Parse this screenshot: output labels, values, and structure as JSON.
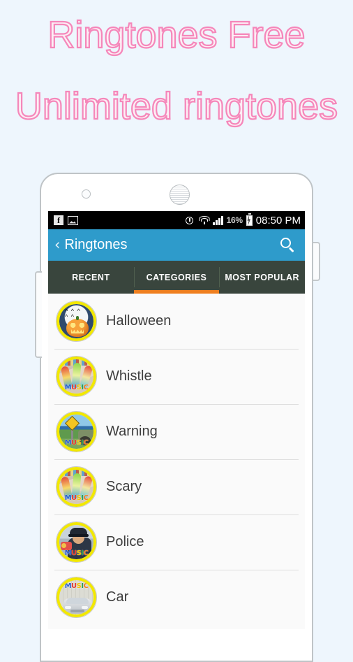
{
  "promo": {
    "line1": "Ringtones Free",
    "line2": "Unlimited ringtones",
    "text_color": "#fdeef5",
    "outline_color": "#f587ba",
    "background_color": "#eef6fd"
  },
  "phone": {
    "frame_color": "#ffffff",
    "frame_border_color": "#bfc4c7",
    "camera": "camera-dot",
    "speaker": "speaker-grille",
    "volume_button": "volume-button",
    "power_button": "power-button"
  },
  "statusbar": {
    "background_color": "#000000",
    "left_icons": [
      "facebook-icon",
      "image-icon"
    ],
    "facebook_glyph": "f",
    "right_icons": [
      "alarm-icon",
      "wifi-icon",
      "signal-icon",
      "battery-icon"
    ],
    "battery_percent": "16%",
    "clock": "08:50 PM"
  },
  "appbar": {
    "background_color": "#2e9bcb",
    "back_glyph": "‹",
    "title": "Ringtones",
    "search_icon": "search-icon"
  },
  "tabs": {
    "background_color": "#39453d",
    "indicator_color": "#ef7f1f",
    "active_index": 1,
    "items": [
      {
        "label": "RECENT"
      },
      {
        "label": "CATEGORIES"
      },
      {
        "label": "MOST POPULAR"
      }
    ]
  },
  "list": {
    "background_color": "#fafafa",
    "separator_color": "#dedede",
    "thumb_ring_color": "#f2e800",
    "music_word": "MUSIC",
    "items": [
      {
        "label": "Halloween",
        "art": "art-halloween",
        "music_word_position": "none"
      },
      {
        "label": "Whistle",
        "art": "art-whistle",
        "music_word_position": "bottom"
      },
      {
        "label": "Warning",
        "art": "art-warning",
        "music_word_position": "bottom"
      },
      {
        "label": "Scary",
        "art": "art-whistle",
        "music_word_position": "bottom"
      },
      {
        "label": "Police",
        "art": "art-police",
        "music_word_position": "bottom"
      },
      {
        "label": "Car",
        "art": "art-car",
        "music_word_position": "top"
      }
    ]
  }
}
